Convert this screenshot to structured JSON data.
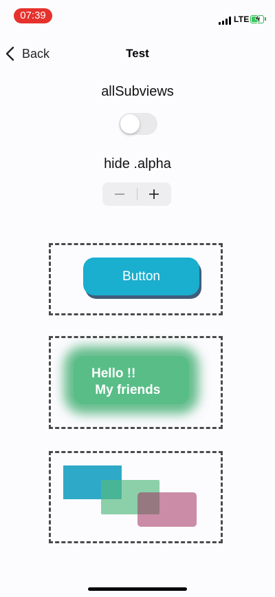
{
  "status_bar": {
    "time": "07:39",
    "network": "LTE",
    "time_pill_color": "#e5322d",
    "battery_color": "#35c759",
    "battery_charging": true
  },
  "nav": {
    "back_label": "Back",
    "title": "Test"
  },
  "controls": {
    "toggle_label": "allSubviews",
    "toggle_on": false,
    "stepper_label": "hide  .alpha",
    "stepper_minus": "−",
    "stepper_plus": "+"
  },
  "demo": {
    "button_label": "Button",
    "button_color": "#1aaecf",
    "glow_card_line1": "Hello !!",
    "glow_card_line2": " My friends",
    "glow_color": "#59bd87",
    "rect_colors": [
      "#2fa9c8",
      "#55bb80",
      "#a0325f"
    ]
  },
  "icons": {
    "back": "chevron-left-icon",
    "signal": "cellular-signal-icon",
    "battery": "battery-charging-icon"
  }
}
